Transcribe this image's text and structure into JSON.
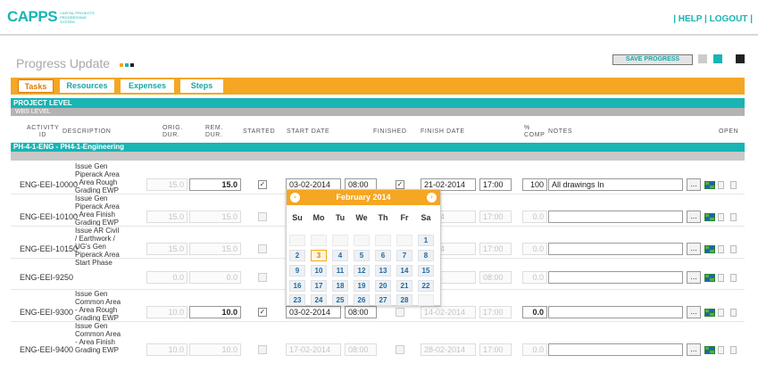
{
  "app": {
    "logo": "CAPPS",
    "logo_sub": "CAPITAL PROJECTS PROGRESSING SYSTEM",
    "links": {
      "help": "HELP",
      "logout": "LOGOUT",
      "sep_left": "| ",
      "sep_mid": " | ",
      "sep_right": " |"
    }
  },
  "page": {
    "title": "Progress Update",
    "save_label": "SAVE PROGRESS"
  },
  "colors": {
    "teal": "#19b4b4",
    "orange": "#f5a623",
    "dark": "#222222",
    "gray": "#cccccc",
    "dots": [
      "#f5a623",
      "#19b4b4",
      "#222222"
    ]
  },
  "tabs": [
    {
      "label": "Tasks",
      "active": true
    },
    {
      "label": "Resources",
      "active": false
    },
    {
      "label": "Expenses",
      "active": false
    },
    {
      "label": "Steps",
      "active": false
    }
  ],
  "bands": {
    "project": "PROJECT LEVEL",
    "wbs": "WBS LEVEL",
    "group": "PH-4-1-ENG - PH4-1-Engineering"
  },
  "columns": {
    "activity_id": "ACTIVITY ID",
    "description": "DESCRIPTION",
    "orig_dur": "ORIG. DUR.",
    "rem_dur": "REM. DUR.",
    "started": "STARTED",
    "start_date": "START DATE",
    "finished": "FINISHED",
    "finish_date": "FINISH DATE",
    "pct_comp": "% COMP",
    "notes": "NOTES",
    "open": "OPEN"
  },
  "rows": [
    {
      "id": "ENG-EEI-10000",
      "description": "Issue Gen Piperack Area - Area Rough Grading EWP",
      "orig": "15.0",
      "rem": "15.0",
      "started": true,
      "start_date": "03-02-2014",
      "start_time": "08:00",
      "finished": true,
      "finish_date": "21-02-2014",
      "finish_time": "17:00",
      "pct": "100",
      "notes": "All drawings In",
      "more": "..."
    },
    {
      "id": "ENG-EEI-10100",
      "description": "Issue Gen Piperack Area - Area Finish Grading EWP",
      "orig": "15.0",
      "rem": "15.0",
      "started": false,
      "start_date": "",
      "start_time": "",
      "finished": false,
      "finish_date": "-2014",
      "finish_time": "17:00",
      "pct": "0.0",
      "notes": "",
      "more": "..."
    },
    {
      "id": "ENG-EEI-10150",
      "description": "Issue AR Civil / Earthwork / UG's Gen Piperack Area",
      "orig": "15.0",
      "rem": "15.0",
      "started": false,
      "start_date": "",
      "start_time": "",
      "finished": false,
      "finish_date": "-2014",
      "finish_time": "17:00",
      "pct": "0.0",
      "notes": "",
      "more": "..."
    },
    {
      "id": "ENG-EEI-9250",
      "description": "Start Phase",
      "orig": "0.0",
      "rem": "0.0",
      "started": false,
      "start_date": "",
      "start_time": "",
      "finished": false,
      "finish_date": "2014",
      "finish_time": "08:00",
      "pct": "0.0",
      "notes": "",
      "more": "..."
    },
    {
      "id": "ENG-EEI-9300",
      "description": "Issue Gen Common Area - Area Rough Grading EWP",
      "orig": "10.0",
      "rem": "10.0",
      "started": true,
      "start_date": "03-02-2014",
      "start_time": "08:00",
      "finished": false,
      "finish_date": "14-02-2014",
      "finish_time": "17:00",
      "pct": "0.0",
      "notes": "",
      "more": "..."
    },
    {
      "id": "ENG-EEI-9400",
      "description": "Issue Gen Common Area - Area Finish Grading EWP",
      "orig": "10.0",
      "rem": "10.0",
      "started": false,
      "start_date": "17-02-2014",
      "start_time": "08:00",
      "finished": false,
      "finish_date": "28-02-2014",
      "finish_time": "17:00",
      "pct": "0.0",
      "notes": "",
      "more": "..."
    }
  ],
  "calendar": {
    "title": "February 2014",
    "prev": "‹",
    "next": "›",
    "dow": [
      "Su",
      "Mo",
      "Tu",
      "We",
      "Th",
      "Fr",
      "Sa"
    ],
    "weeks": [
      [
        "",
        "",
        "",
        "",
        "",
        "",
        "1"
      ],
      [
        "2",
        "3",
        "4",
        "5",
        "6",
        "7",
        "8"
      ],
      [
        "9",
        "10",
        "11",
        "12",
        "13",
        "14",
        "15"
      ],
      [
        "16",
        "17",
        "18",
        "19",
        "20",
        "21",
        "22"
      ],
      [
        "23",
        "24",
        "25",
        "26",
        "27",
        "28",
        ""
      ]
    ],
    "today": "3"
  }
}
